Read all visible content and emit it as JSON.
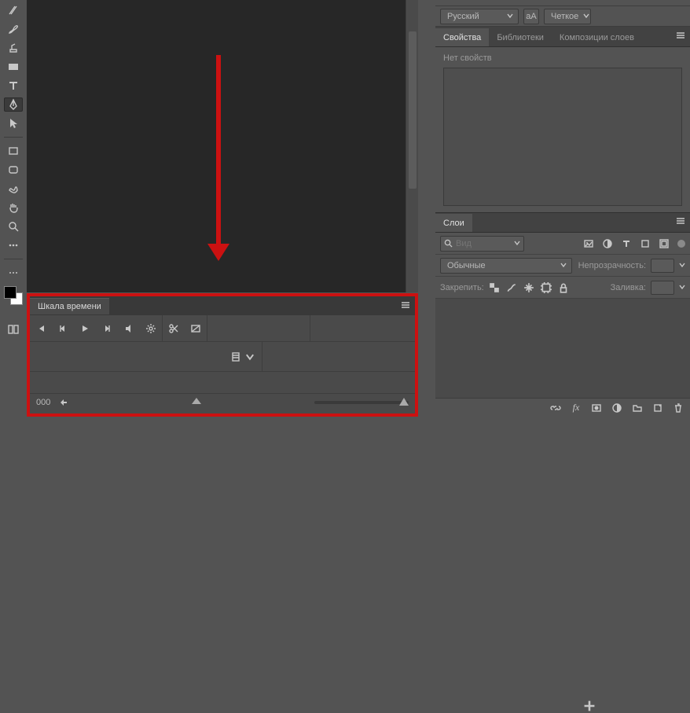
{
  "options": {
    "language": "Русский",
    "aa_label": "aA",
    "sharpness": "Четкое"
  },
  "properties_panel": {
    "tabs": {
      "properties": "Свойства",
      "libraries": "Библиотеки",
      "layer_comps": "Композиции слоев"
    },
    "empty_text": "Нет свойств"
  },
  "layers_panel": {
    "tab": "Слои",
    "search_placeholder": "Вид",
    "blend_mode": "Обычные",
    "opacity_label": "Непрозрачность:",
    "lock_label": "Закрепить:",
    "fill_label": "Заливка:"
  },
  "timeline": {
    "tab": "Шкала времени",
    "frame_counter": "000"
  }
}
